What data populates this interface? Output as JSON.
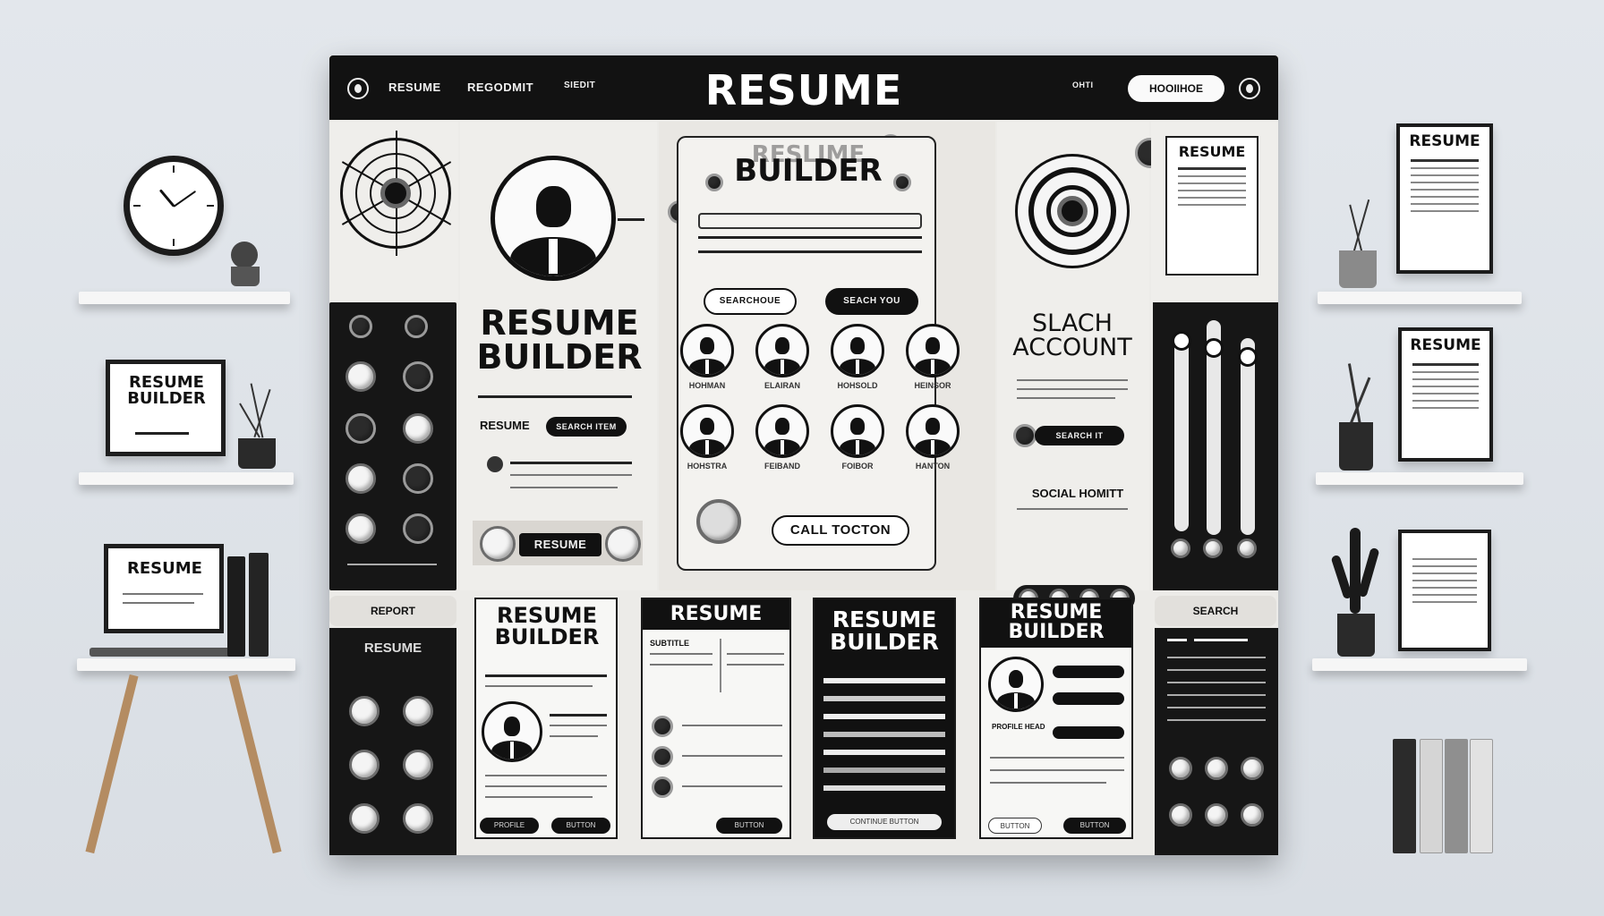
{
  "topbar": {
    "title": "RESUME BUILDER",
    "links": [
      "RESUME",
      "REGODMIT",
      "SIEDIT"
    ],
    "small_link": "OHTI",
    "pill_label": "HOOIIHOE"
  },
  "left_panel": {
    "heading": "RESUME BUILDER",
    "field_label": "RESUME",
    "field_pill": "SEARCH ITEM",
    "button_label": "RESUME"
  },
  "center_panel": {
    "heading_faded": "RESLIME",
    "heading": "BUILDER",
    "btn_left": "SEARCHOUE",
    "btn_right": "SEACH YOU",
    "profile_labels": [
      "HOHMAN",
      "ELAIRAN",
      "HOHSOLD",
      "HEINSOR",
      "HOHSTRA",
      "FEIBAND",
      "FOIBOR",
      "HANTON"
    ],
    "call_button": "CALL TOCTON"
  },
  "right_panel": {
    "heading": "SLACH ACCOUNT",
    "pill": "SEARCH IT",
    "social_label": "SOCIAL HOMITT"
  },
  "far_right_card": {
    "title": "RESUME"
  },
  "bottom": {
    "report_label": "REPORT",
    "resume_label": "RESUME",
    "cards": [
      {
        "title": "RESUME BUILDER",
        "btn_left": "PROFILE",
        "btn_right": "BUTTON"
      },
      {
        "title": "RESUME",
        "label": "SUBTITLE",
        "btn": "BUTTON"
      },
      {
        "title": "RESUME BUILDER",
        "btn": "CONTINUE BUTTON"
      },
      {
        "title": "RESUME BUILDER",
        "text": "PROFILE HEAD",
        "btn_left": "BUTTON",
        "btn_right": "BUTTON"
      }
    ],
    "search_label": "SEARCH"
  },
  "decor": {
    "monitor_title": "RESUME BUILDER",
    "laptop_title": "RESUME",
    "frames": [
      "RESUME",
      "RESUME",
      ""
    ]
  },
  "colors": {
    "background": "#e3e7ec",
    "bar": "#121212",
    "panel": "#efeeeb"
  }
}
